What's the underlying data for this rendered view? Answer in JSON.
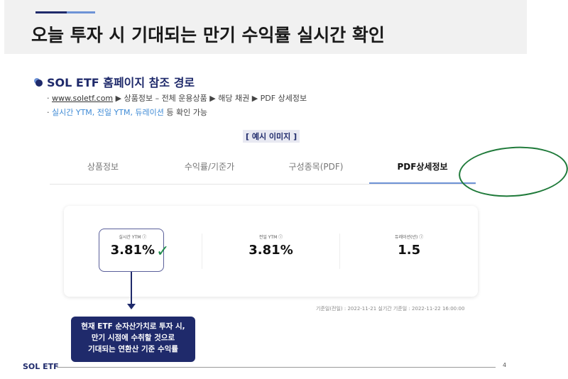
{
  "header": {
    "title": "오늘 투자 시 기대되는 만기 수익률 실시간 확인"
  },
  "section": {
    "title": "SOL ETF 홈페이지 참조 경로",
    "path_link": "www.soletf.com",
    "path_rest": " ▶ 상품정보 – 전체 운용상품 ▶ 해당 채권 ▶ PDF 상세정보",
    "line2_blue": "실시간 YTM, 전일 YTM, 듀레이션",
    "line2_rest": " 등 확인 가능"
  },
  "example_label": "[ 예시 이미지 ]",
  "tabs": [
    {
      "label": "상품정보"
    },
    {
      "label": "수익률/기준가"
    },
    {
      "label": "구성종목(PDF)"
    },
    {
      "label": "PDF상세정보"
    }
  ],
  "stats": [
    {
      "label": "실시간 YTM ⓘ",
      "value": "3.81%"
    },
    {
      "label": "전일 YTM ⓘ",
      "value": "3.81%"
    },
    {
      "label": "듀레이션(년) ⓘ",
      "value": "1.5"
    }
  ],
  "note": "기준일(전일) : 2022-11-21 실기간 기준일 : 2022-11-22 16:00:00",
  "callout": [
    "현재 ETF 순자산가치로 투자 시,",
    "만기 시점에 수취할 것으로",
    "기대되는 연환산 기준 수익률"
  ],
  "footer": {
    "brand": "SOL ETF",
    "page": "4"
  }
}
